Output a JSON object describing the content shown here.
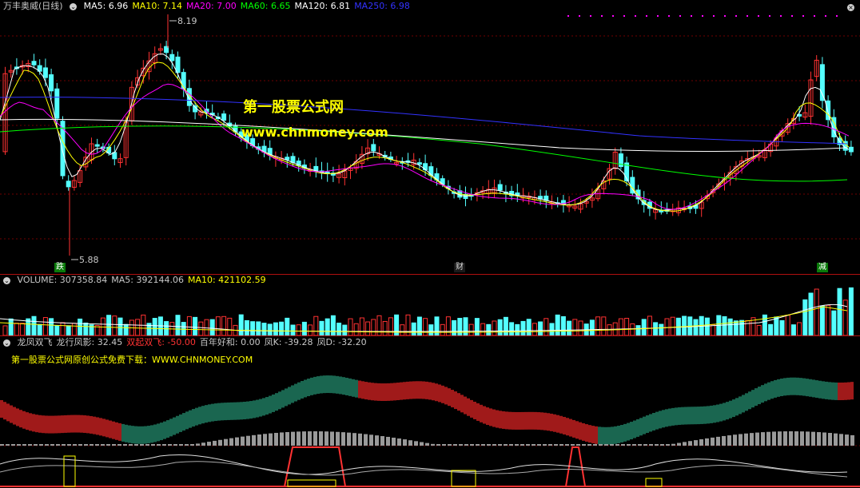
{
  "colors": {
    "up": "#ff3232",
    "down": "#54ffff",
    "ma5": "#ffffff",
    "ma10": "#ffff00",
    "ma20": "#ff00ff",
    "ma60": "#00ff00",
    "ma120": "#ffffff",
    "ma250": "#3232ff",
    "red": "#ff3232",
    "grid": "#700000"
  },
  "main": {
    "title": "万丰奥威(日线)",
    "ma": [
      {
        "label": "MA5: 6.96",
        "color": "#ffffff"
      },
      {
        "label": "MA10: 7.14",
        "color": "#ffff00"
      },
      {
        "label": "MA20: 7.00",
        "color": "#ff00ff"
      },
      {
        "label": "MA60: 6.65",
        "color": "#00ff00"
      },
      {
        "label": "MA120: 6.81",
        "color": "#ffffff"
      },
      {
        "label": "MA250: 6.98",
        "color": "#3232ff"
      }
    ],
    "high_label": "8.19",
    "low_label": "5.88",
    "watermark1": "第一股票公式网",
    "watermark2": "www.chnmoney.com",
    "badges": [
      {
        "text": "跌",
        "icon": "green-tag"
      },
      {
        "text": "财",
        "icon": "dark-tag"
      },
      {
        "text": "减",
        "icon": "green-tag"
      }
    ]
  },
  "volume": {
    "labels": [
      {
        "text": "VOLUME: 307358.84",
        "color": "#c8c8c8"
      },
      {
        "text": "MA5: 392144.06",
        "color": "#c8c8c8"
      },
      {
        "text": "MA10: 421102.59",
        "color": "#ffff00"
      }
    ]
  },
  "indicator": {
    "labels": [
      {
        "text": "龙凤双飞",
        "color": "#c8c8c8"
      },
      {
        "text": "龙行凤影: 32.45",
        "color": "#c8c8c8"
      },
      {
        "text": "双起双飞: -50.00",
        "color": "#ff3232"
      },
      {
        "text": "百年好和: 0.00",
        "color": "#c8c8c8"
      },
      {
        "text": "凤K: -39.28",
        "color": "#c8c8c8"
      },
      {
        "text": "凤D: -32.20",
        "color": "#c8c8c8"
      }
    ],
    "note": "第一股票公式网原创公式免费下载：WWW.CHNMONEY.COM"
  }
}
